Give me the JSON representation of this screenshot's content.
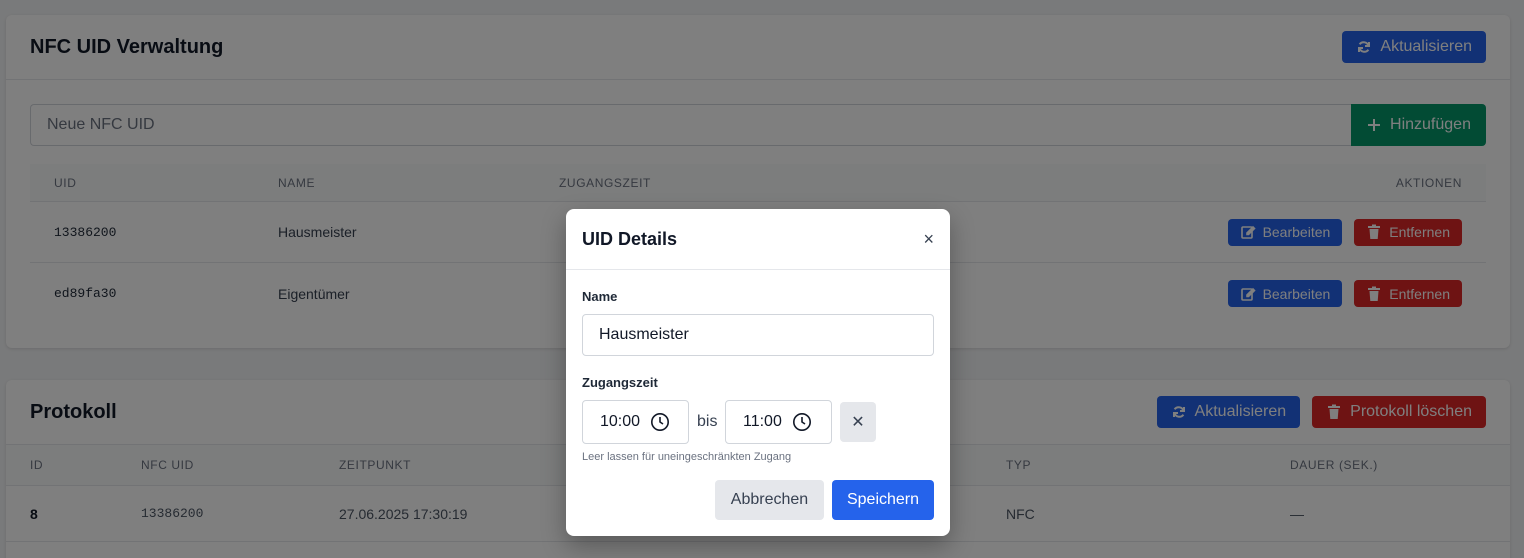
{
  "nfc_card": {
    "title": "NFC UID Verwaltung",
    "refresh_label": "Aktualisieren",
    "input_placeholder": "Neue NFC UID",
    "add_label": "Hinzufügen",
    "columns": [
      "UID",
      "NAME",
      "ZUGANGSZEIT",
      "AKTIONEN"
    ],
    "rows": [
      {
        "uid": "13386200",
        "name": "Hausmeister",
        "zugangszeit": ""
      },
      {
        "uid": "ed89fa30",
        "name": "Eigentümer",
        "zugangszeit": ""
      }
    ],
    "edit_label": "Bearbeiten",
    "remove_label": "Entfernen"
  },
  "log_card": {
    "title": "Protokoll",
    "refresh_label": "Aktualisieren",
    "clear_label": "Protokoll löschen",
    "columns": [
      "ID",
      "NFC UID",
      "ZEITPUNKT",
      "TYP",
      "DAUER (SEK.)"
    ],
    "rows": [
      {
        "id": "8",
        "uid": "13386200",
        "zeitpunkt": "27.06.2025 17:30:19",
        "typ": "NFC",
        "dauer": "—"
      }
    ]
  },
  "modal": {
    "title": "UID Details",
    "close_glyph": "×",
    "name_label": "Name",
    "name_value": "Hausmeister",
    "access_label": "Zugangszeit",
    "time_from": "10:00",
    "bis_label": "bis",
    "time_to": "11:00",
    "clear_glyph": "✕",
    "hint": "Leer lassen für uneingeschränkten Zugang",
    "cancel_label": "Abbrechen",
    "save_label": "Speichern"
  },
  "colors": {
    "primary": "#2563eb",
    "danger": "#dc2626",
    "success": "#059669",
    "overlay": "rgba(0,0,0,0.5)"
  },
  "icons": [
    "refresh-icon",
    "plus-icon",
    "edit-icon",
    "trash-icon",
    "clock-icon",
    "close-icon"
  ]
}
